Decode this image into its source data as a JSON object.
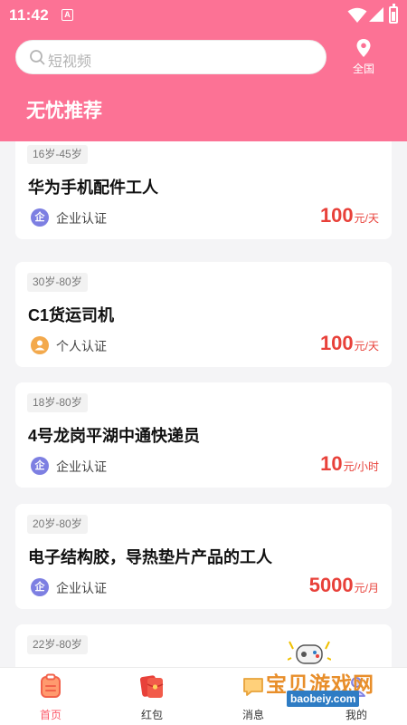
{
  "status_bar": {
    "time": "11:42",
    "app_icon_letter": "A"
  },
  "header": {
    "search_placeholder": "短视频",
    "location_label": "全国",
    "title": "无忧推荐",
    "color": "#fc7295"
  },
  "jobs": [
    {
      "age_range": "16岁-45岁",
      "title": "华为手机配件工人",
      "verify_type": "company",
      "verify_icon": "企",
      "verify_label": "企业认证",
      "salary": "100",
      "unit": "元/天"
    },
    {
      "age_range": "30岁-80岁",
      "title": "C1货运司机",
      "verify_type": "personal",
      "verify_icon": "person-icon",
      "verify_label": "个人认证",
      "salary": "100",
      "unit": "元/天"
    },
    {
      "age_range": "18岁-80岁",
      "title": "4号龙岗平湖中通快递员",
      "verify_type": "company",
      "verify_icon": "企",
      "verify_label": "企业认证",
      "salary": "10",
      "unit": "元/小时"
    },
    {
      "age_range": "20岁-80岁",
      "title": "电子结构胶，导热垫片产品的工人",
      "verify_type": "company",
      "verify_icon": "企",
      "verify_label": "企业认证",
      "salary": "5000",
      "unit": "元/月"
    },
    {
      "age_range": "22岁-80岁"
    }
  ],
  "nav": {
    "items": [
      {
        "label": "首页",
        "icon": "home-clipboard-icon",
        "active": true
      },
      {
        "label": "红包",
        "icon": "red-envelope-icon",
        "active": false
      },
      {
        "label": "消息",
        "icon": "message-icon",
        "active": false
      },
      {
        "label": "我的",
        "icon": "profile-icon",
        "active": false
      }
    ]
  },
  "watermark": {
    "text": "宝贝游戏网",
    "url": "baobeiy.com"
  },
  "colors": {
    "accent": "#fc7295",
    "salary": "#e8413a",
    "company_badge": "#7d7fe2",
    "personal_badge": "#f3a94c",
    "nav_active": "#fc5a6a"
  }
}
